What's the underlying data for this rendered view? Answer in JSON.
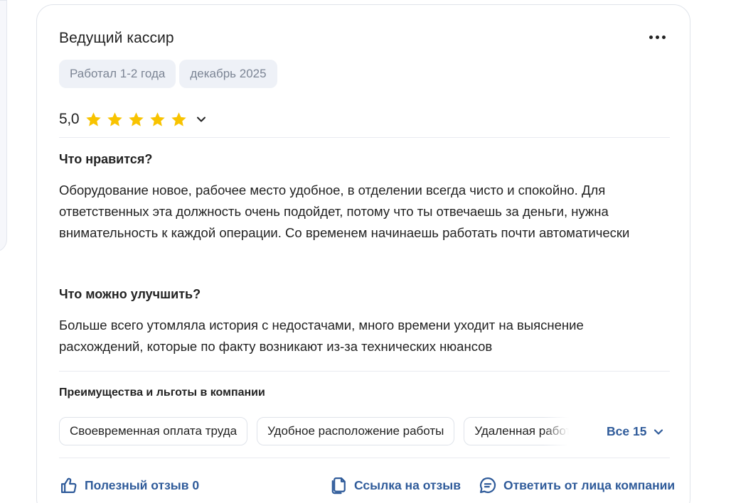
{
  "review": {
    "title": "Ведущий кассир",
    "tags": [
      "Работал 1-2 года",
      "декабрь 2025"
    ],
    "rating": "5,0",
    "stars": 5,
    "star_color": "#f8c300",
    "likes_heading": "Что нравится?",
    "likes_text": "Оборудование новое, рабочее место удобное, в отделении всегда чисто и спокойно. Для ответственных эта должность очень подойдет, потому что ты отвечаешь за деньги, нужна внимательность к каждой операции. Со временем начинаешь работать почти автоматически",
    "improve_heading": "Что можно улучшить?",
    "improve_text": "Больше всего утомляла история с недостачами, много времени уходит на выяснение расхождений, которые по факту возникают из-за технических нюансов"
  },
  "benefits": {
    "title": "Преимущества и льготы в компании",
    "chips": [
      "Своевременная оплата труда",
      "Удобное расположение работы",
      "Удаленная работа"
    ],
    "all_label": "Все 15"
  },
  "actions": {
    "helpful_label": "Полезный отзыв 0",
    "link_label": "Ссылка на отзыв",
    "reply_label": "Ответить от лица компании"
  },
  "colors": {
    "accent": "#2f5b9a",
    "tag_bg": "#eef1f7",
    "tag_text": "#7b8494",
    "border": "#dfe3ea"
  },
  "icons": {
    "more": "more-dots-icon",
    "star": "star-icon",
    "chevron": "chevron-down-icon",
    "thumb": "thumbs-up-icon",
    "link": "copy-link-icon",
    "reply": "chat-bubble-icon"
  }
}
